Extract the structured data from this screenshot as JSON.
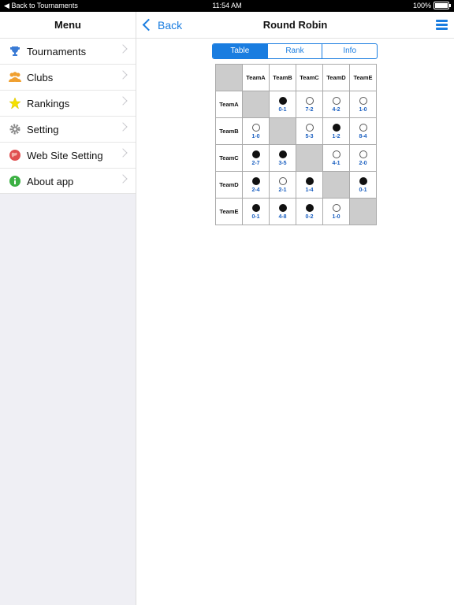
{
  "status_bar": {
    "back_text": "Back to Tournaments",
    "time": "11:54 AM",
    "battery": "100%"
  },
  "sidebar": {
    "title": "Menu",
    "items": [
      {
        "label": "Tournaments",
        "icon": "trophy-icon",
        "color": "#3a7bd5"
      },
      {
        "label": "Clubs",
        "icon": "people-icon",
        "color": "#f0a030"
      },
      {
        "label": "Rankings",
        "icon": "star-icon",
        "color": "#f5e000"
      },
      {
        "label": "Setting",
        "icon": "gear-icon",
        "color": "#888888"
      },
      {
        "label": "Web Site Setting",
        "icon": "globe-icon",
        "color": "#e05050"
      },
      {
        "label": "About app",
        "icon": "info-icon",
        "color": "#3cb043"
      }
    ]
  },
  "nav": {
    "back_label": "Back",
    "title": "Round Robin"
  },
  "tabs": [
    {
      "label": "Table",
      "active": true
    },
    {
      "label": "Rank",
      "active": false
    },
    {
      "label": "Info",
      "active": false
    }
  ],
  "table": {
    "teams": [
      "TeamA",
      "TeamB",
      "TeamC",
      "TeamD",
      "TeamE"
    ],
    "rows": [
      [
        null,
        {
          "result": "win",
          "score": "0-1"
        },
        {
          "result": "loss",
          "score": "7-2"
        },
        {
          "result": "loss",
          "score": "4-2"
        },
        {
          "result": "loss",
          "score": "1-0"
        }
      ],
      [
        {
          "result": "loss",
          "score": "1-0"
        },
        null,
        {
          "result": "loss",
          "score": "5-3"
        },
        {
          "result": "win",
          "score": "1-2"
        },
        {
          "result": "loss",
          "score": "8-4"
        }
      ],
      [
        {
          "result": "win",
          "score": "2-7"
        },
        {
          "result": "win",
          "score": "3-5"
        },
        null,
        {
          "result": "loss",
          "score": "4-1"
        },
        {
          "result": "loss",
          "score": "2-0"
        }
      ],
      [
        {
          "result": "win",
          "score": "2-4"
        },
        {
          "result": "loss",
          "score": "2-1"
        },
        {
          "result": "win",
          "score": "1-4"
        },
        null,
        {
          "result": "win",
          "score": "0-1"
        }
      ],
      [
        {
          "result": "win",
          "score": "0-1"
        },
        {
          "result": "win",
          "score": "4-8"
        },
        {
          "result": "win",
          "score": "0-2"
        },
        {
          "result": "loss",
          "score": "1-0"
        },
        null
      ]
    ]
  },
  "colors": {
    "accent": "#1a7de0",
    "score": "#1a5fc0",
    "diagonal": "#cccccc"
  }
}
